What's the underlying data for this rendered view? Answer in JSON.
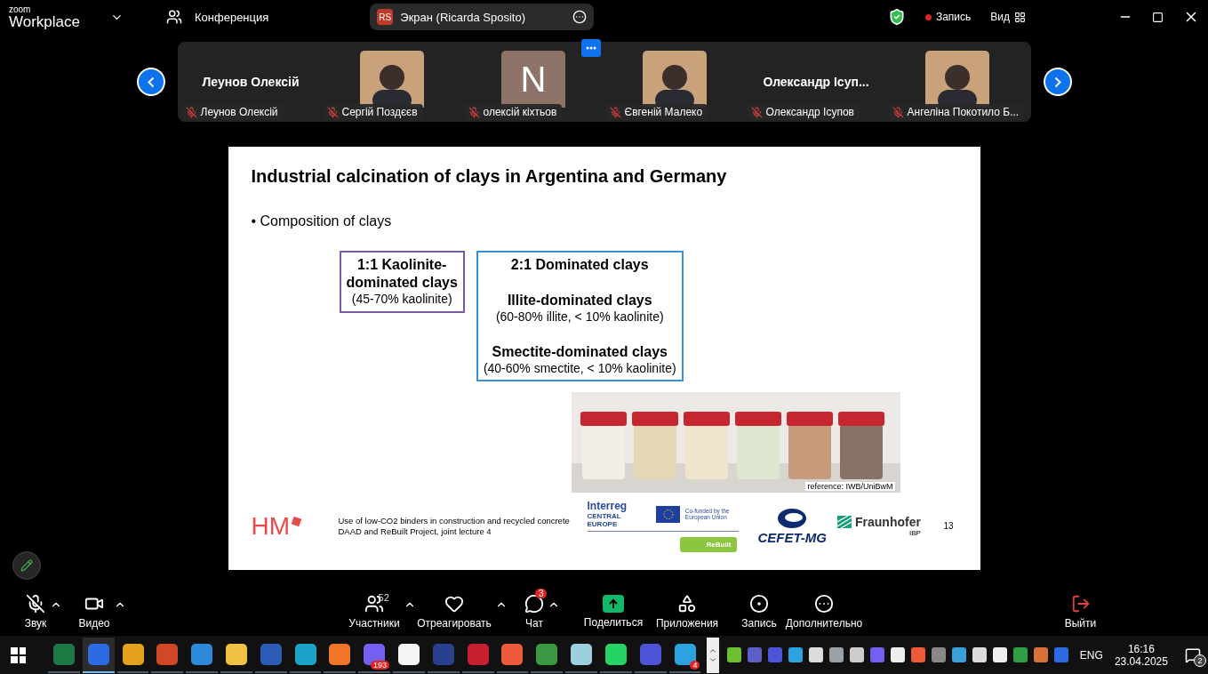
{
  "top_bar": {
    "logo_small": "zoom",
    "logo": "Workplace",
    "meeting": "Конференция",
    "share": {
      "initials": "RS",
      "label": "Экран (Ricarda Sposito)"
    },
    "recording": "Запись",
    "view": "Вид"
  },
  "participants": [
    {
      "kind": "name",
      "tile_text": "Леунов Олексій",
      "name": "Леунов Олексій",
      "muted": true
    },
    {
      "kind": "picture",
      "name": "Сергій Поздєєв",
      "muted": true
    },
    {
      "kind": "initial",
      "tile_text": "N",
      "name": "олексій кіхтьов",
      "muted": true
    },
    {
      "kind": "picture",
      "name": "Євгеній Малеко",
      "muted": true
    },
    {
      "kind": "name",
      "tile_text": "Олександр Ісуп...",
      "name": "Олександр Ісупов",
      "muted": true
    },
    {
      "kind": "picture",
      "name": "Ангеліна Покотило Б...",
      "muted": true
    }
  ],
  "slide": {
    "title": "Industrial calcination of clays in Argentina and Germany",
    "bullet": "Composition of clays",
    "bullet_mark": "•",
    "boxes": [
      {
        "color": "#7b5aa6",
        "lines": [
          {
            "text": "1:1 Kaolinite-",
            "bold": true,
            "spaced": false
          },
          {
            "text": "dominated clays",
            "bold": true,
            "spaced": false
          },
          {
            "text": "(45-70% kaolinite)",
            "bold": false,
            "spaced": false
          }
        ]
      },
      {
        "color": "#3b8fd4",
        "lines": [
          {
            "text": "2:1 Dominated clays",
            "bold": true,
            "spaced": false
          },
          {
            "text": "Illite-dominated clays",
            "bold": true,
            "spaced": true
          },
          {
            "text": "(60-80% illite, < 10% kaolinite)",
            "bold": false,
            "spaced": false
          },
          {
            "text": "Smectite-dominated clays",
            "bold": true,
            "spaced": true
          },
          {
            "text": "(40-60% smectite, < 10% kaolinite)",
            "bold": false,
            "spaced": false
          }
        ]
      }
    ],
    "photo_caption": "reference: IWB/UniBwM",
    "footer": {
      "hm": "HM",
      "lines": [
        "Use of low-CO2 binders in construction and recycled concrete",
        "DAAD and ReBuilt Project, joint lecture 4"
      ],
      "interreg": "Interreg",
      "central": "CENTRAL EUROPE",
      "eu": "Co-funded by the European Union",
      "rebuilt": "ReBuilt",
      "cefet": "CEFET-MG",
      "fraunhofer": "Fraunhofer",
      "ibp": "IBP",
      "page": "13"
    }
  },
  "toolbar": [
    {
      "kind": "mic",
      "label": "Звук",
      "muted": true,
      "caret": true
    },
    {
      "kind": "video",
      "label": "Видео",
      "caret": true
    },
    {
      "kind": "people",
      "label": "Участники",
      "count": "52",
      "caret": true
    },
    {
      "kind": "heart",
      "label": "Отреагировать",
      "caret": true
    },
    {
      "kind": "chat",
      "label": "Чат",
      "badge": "3",
      "caret": true
    },
    {
      "kind": "share",
      "label": "Поделиться",
      "caret": false
    },
    {
      "kind": "apps",
      "label": "Приложения",
      "caret": false
    },
    {
      "kind": "record",
      "label": "Запись",
      "caret": false
    },
    {
      "kind": "more",
      "label": "Дополнительно",
      "caret": false
    },
    {
      "kind": "leave",
      "label": "Выйти",
      "caret": false
    }
  ],
  "taskbar": {
    "apps": [
      {
        "color": "#1d7a45",
        "selected": false
      },
      {
        "color": "#2d6be4",
        "selected": true
      },
      {
        "color": "#e3a21a",
        "selected": false
      },
      {
        "color": "#d24726",
        "selected": false
      },
      {
        "color": "#2c8ad8",
        "selected": false
      },
      {
        "color": "#f0c243",
        "selected": false
      },
      {
        "color": "#2b5cb8",
        "selected": false
      },
      {
        "color": "#1aa2c9",
        "selected": false
      },
      {
        "color": "#f2752a",
        "selected": false
      },
      {
        "color": "#7360f2",
        "selected": false,
        "badge": "193"
      },
      {
        "color": "#f4f4f4",
        "selected": false
      },
      {
        "color": "#2a3f8f",
        "selected": false
      },
      {
        "color": "#c8202f",
        "selected": false
      },
      {
        "color": "#ec5a38",
        "selected": false
      },
      {
        "color": "#3a9a44",
        "selected": false
      },
      {
        "color": "#9ad0e0",
        "selected": false
      },
      {
        "color": "#25d366",
        "selected": false
      },
      {
        "color": "#4d55d6",
        "selected": false
      },
      {
        "color": "#2aa3e0",
        "selected": false,
        "badge": "4"
      }
    ],
    "tray": [
      {
        "color": "#6cbf2f"
      },
      {
        "color": "#5b5fc7"
      },
      {
        "color": "#4d55d6"
      },
      {
        "color": "#2aa3e0"
      },
      {
        "color": "#dddddd"
      },
      {
        "color": "#9aa0a8"
      },
      {
        "color": "#cccccc"
      },
      {
        "color": "#7360f2"
      },
      {
        "color": "#eeeeee"
      },
      {
        "color": "#ec5a38"
      },
      {
        "color": "#888888"
      },
      {
        "color": "#3aa0d8"
      },
      {
        "color": "#dddddd"
      },
      {
        "color": "#eeeeee"
      },
      {
        "color": "#2f9e44"
      },
      {
        "color": "#d9703a"
      },
      {
        "color": "#2d6be4"
      }
    ],
    "lang": "ENG",
    "time": "16:16",
    "date": "23.04.2025",
    "notifications": "2"
  }
}
